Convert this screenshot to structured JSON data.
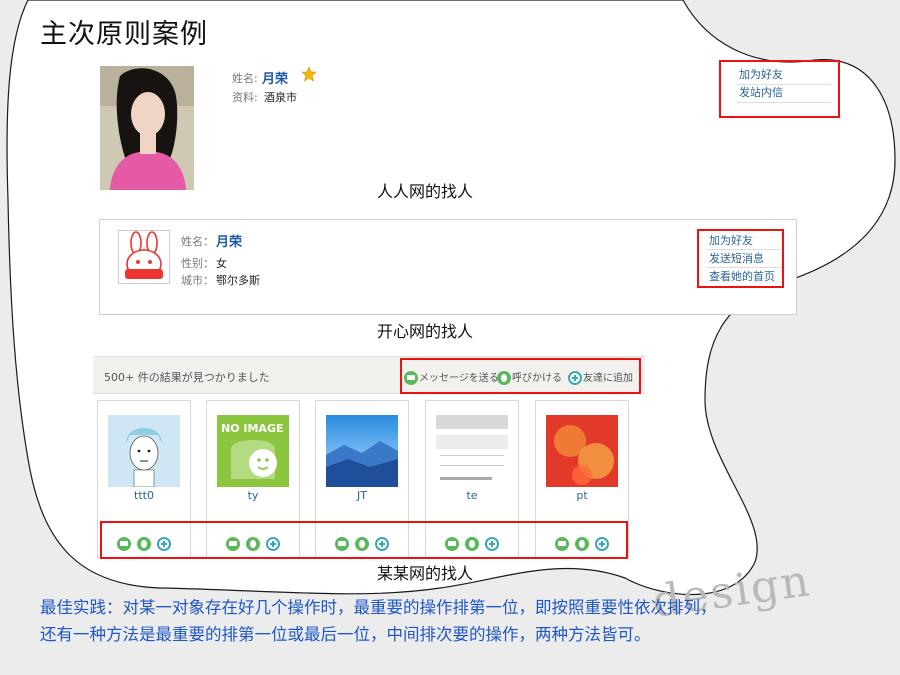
{
  "slide_title": "主次原则案例",
  "renren": {
    "name_label": "姓名:",
    "name": "月荣",
    "info_label": "资料:",
    "info": "酒泉市",
    "actions": [
      "加为好友",
      "发站内信"
    ],
    "caption": "人人网的找人"
  },
  "kaixin": {
    "name_label": "姓名：",
    "name": "月荣",
    "gender_label": "性别：",
    "gender": "女",
    "city_label": "城市：",
    "city": "鄂尔多斯",
    "actions": [
      "加为好友",
      "发送短消息",
      "查看她的首页"
    ],
    "caption": "开心网的找人"
  },
  "mixi": {
    "result_text": "500+ 件の結果が見つかりました",
    "top_actions": [
      "メッセージを送る",
      "呼びかける",
      "友達に追加"
    ],
    "noimage_text": "NO IMAGE",
    "users": [
      "ttt0",
      "ty",
      "JT",
      "te",
      "pt"
    ],
    "caption": "某某网的找人"
  },
  "note": {
    "line1": "最佳实践：对某一对象存在好几个操作时，最重要的操作排第一位，即按照重要性依次排列，",
    "line2": "还有一种方法是最重要的排第一位或最后一位，中间排次要的操作，两种方法皆可。"
  },
  "decoration": "design",
  "colors": {
    "accent_red": "#e11111",
    "link_blue": "#2a6496",
    "note_blue": "#1f57c7",
    "action_green": "#5cb85c",
    "add_teal": "#39a8b8"
  },
  "icons": [
    "star-icon",
    "message-icon",
    "call-icon",
    "add-friend-icon"
  ]
}
